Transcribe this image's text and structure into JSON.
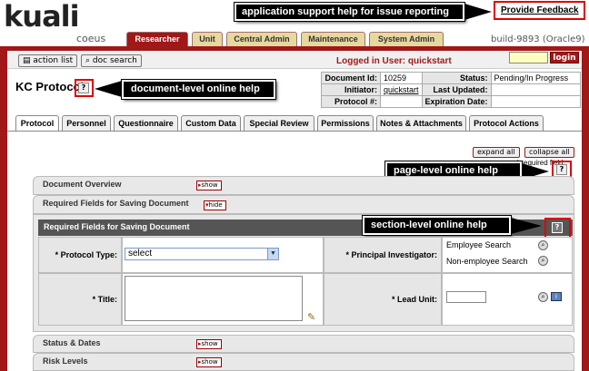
{
  "logo": {
    "main": "kuali",
    "sub": "coeus"
  },
  "callouts": {
    "support": "application support help for issue reporting",
    "document_help": "document-level online help",
    "page_help": "page-level online help",
    "section_help": "section-level online help"
  },
  "header": {
    "feedback": "Provide Feedback",
    "build": "build-9893 (Oracle9)",
    "login_button": "login",
    "logged_in": "Logged in User: quickstart",
    "action_list": "action list",
    "doc_search": "doc search"
  },
  "top_tabs": [
    {
      "label": "Researcher",
      "active": true
    },
    {
      "label": "Unit",
      "active": false
    },
    {
      "label": "Central Admin",
      "active": false
    },
    {
      "label": "Maintenance",
      "active": false
    },
    {
      "label": "System Admin",
      "active": false
    }
  ],
  "page_title": "KC Protocol",
  "meta": {
    "doc_id_label": "Document Id:",
    "doc_id": "10259",
    "status_label": "Status:",
    "status": "Pending/In Progress",
    "initiator_label": "Initiator:",
    "initiator": "quickstart",
    "last_updated_label": "Last Updated:",
    "last_updated": "",
    "protocol_no_label": "Protocol #:",
    "protocol_no": "",
    "expiration_label": "Expiration Date:",
    "expiration": ""
  },
  "doc_tabs": [
    {
      "label": "Protocol",
      "active": true
    },
    {
      "label": "Personnel",
      "active": false
    },
    {
      "label": "Questionnaire",
      "active": false
    },
    {
      "label": "Custom Data",
      "active": false
    },
    {
      "label": "Special Review",
      "active": false
    },
    {
      "label": "Permissions",
      "active": false
    },
    {
      "label": "Notes & Attachments",
      "active": false
    },
    {
      "label": "Protocol Actions",
      "active": false
    }
  ],
  "controls": {
    "expand_all": "expand all",
    "collapse_all": "collapse all",
    "required_field": "* required field"
  },
  "sections": {
    "doc_overview": "Document Overview",
    "required_fields": "Required Fields for Saving Document",
    "required_header": "Required Fields for Saving Document",
    "status_dates": "Status & Dates",
    "risk_levels": "Risk Levels",
    "show": "show",
    "hide": "hide"
  },
  "form": {
    "protocol_type_label": "* Protocol Type:",
    "protocol_type_value": "select",
    "pi_label": "* Principal Investigator:",
    "employee_search": "Employee Search",
    "nonemployee_search": "Non-employee Search",
    "title_label": "* Title:",
    "lead_unit_label": "* Lead Unit:"
  }
}
